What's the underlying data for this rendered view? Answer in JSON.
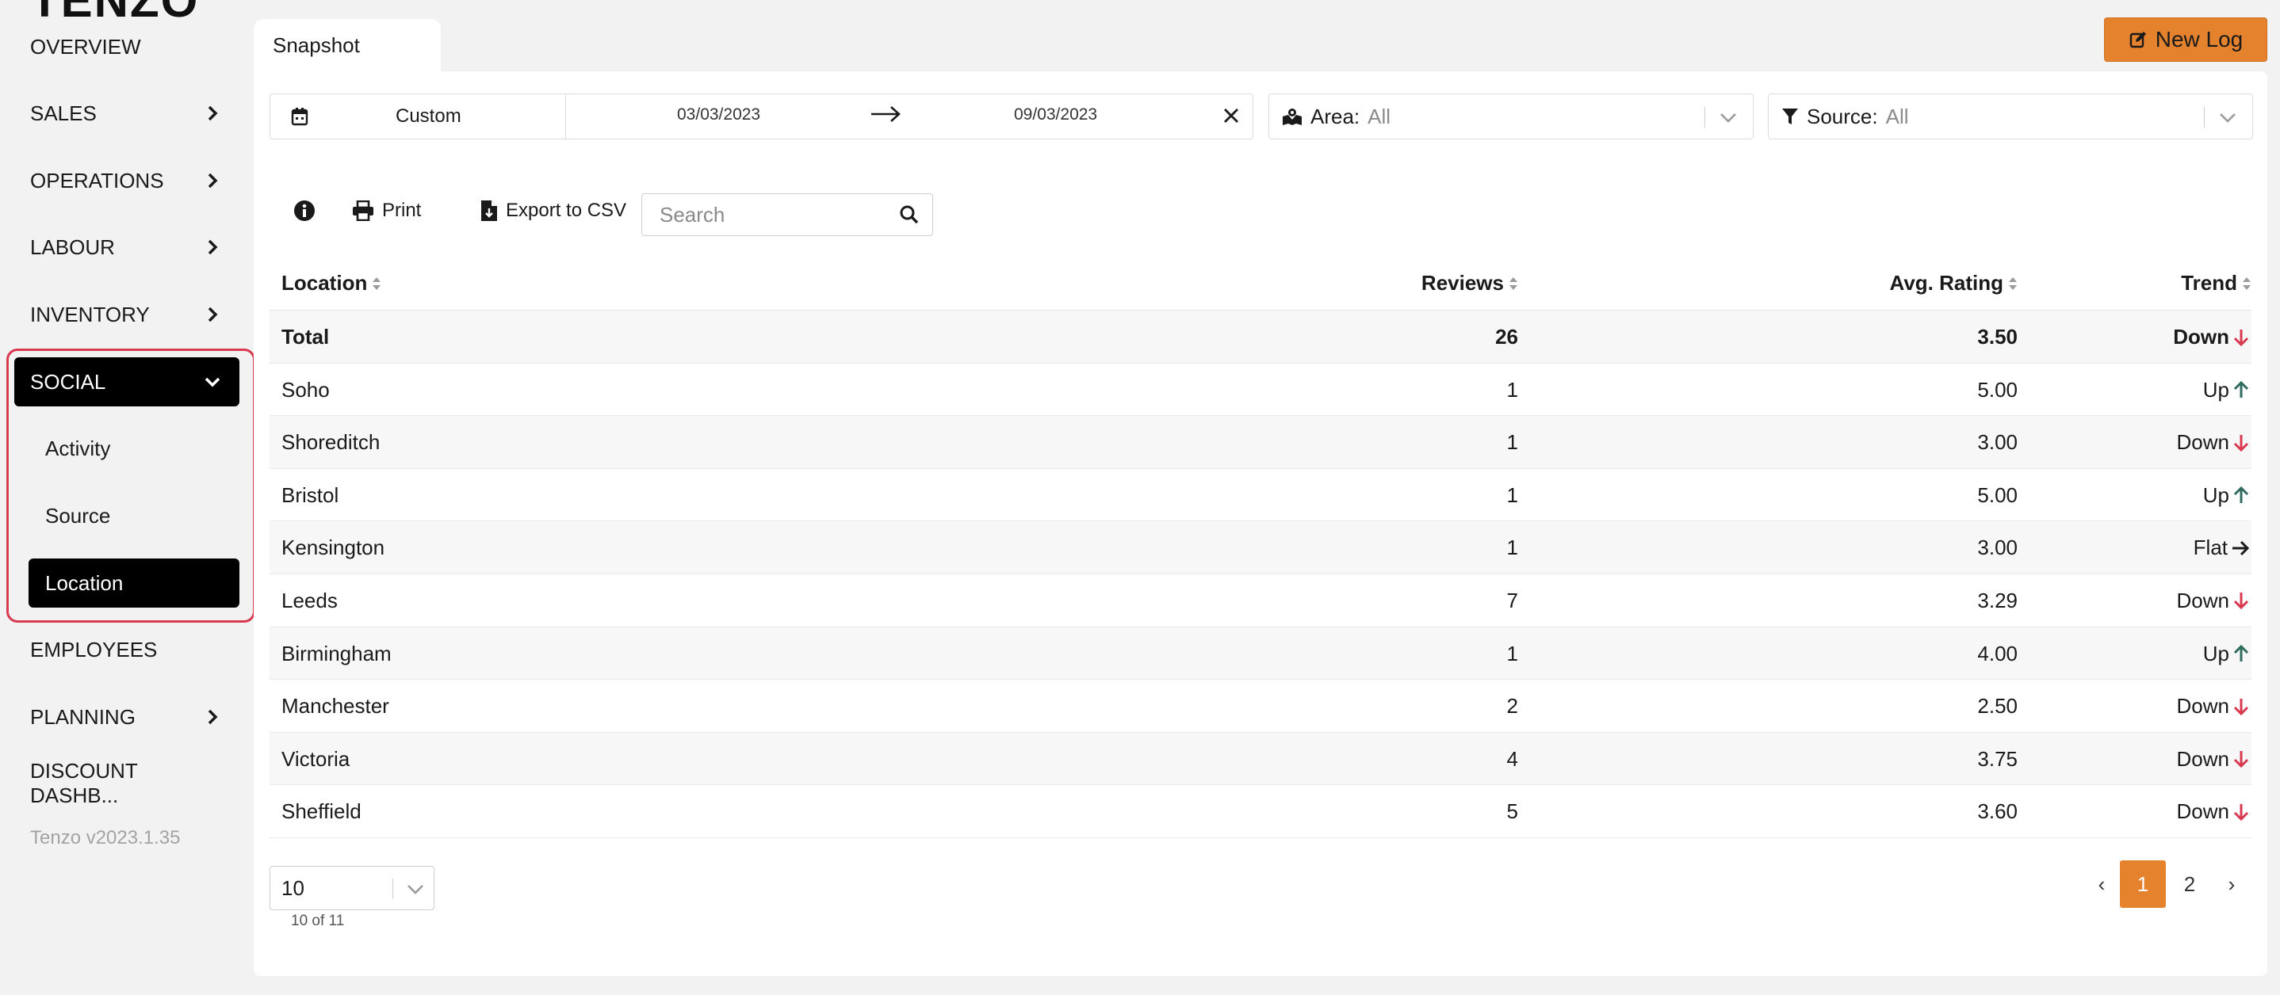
{
  "app": {
    "logo_text": "TENZO",
    "version": "Tenzo v2023.1.35"
  },
  "sidebar": {
    "items": [
      {
        "label": "OVERVIEW"
      },
      {
        "label": "SALES"
      },
      {
        "label": "OPERATIONS"
      },
      {
        "label": "LABOUR"
      },
      {
        "label": "INVENTORY"
      },
      {
        "label": "SOCIAL"
      },
      {
        "label": "EMPLOYEES"
      },
      {
        "label": "PLANNING"
      },
      {
        "label": "DISCOUNT DASHB..."
      }
    ],
    "social_sub": [
      {
        "label": "Activity"
      },
      {
        "label": "Source"
      },
      {
        "label": "Location"
      }
    ]
  },
  "header": {
    "tab_label": "Snapshot",
    "new_log_label": "New Log"
  },
  "filters": {
    "date_preset": "Custom",
    "date_from": "03/03/2023",
    "date_to": "09/03/2023",
    "area_label": "Area:",
    "area_value": "All",
    "source_label": "Source:",
    "source_value": "All"
  },
  "toolbar": {
    "print_label": "Print",
    "export_label": "Export to CSV",
    "search_placeholder": "Search"
  },
  "table": {
    "headers": {
      "location": "Location",
      "reviews": "Reviews",
      "avg_rating": "Avg. Rating",
      "trend": "Trend"
    },
    "rows": [
      {
        "location": "Total",
        "reviews": "26",
        "avg": "3.50",
        "trend": "Down",
        "dir": "down"
      },
      {
        "location": "Soho",
        "reviews": "1",
        "avg": "5.00",
        "trend": "Up",
        "dir": "up"
      },
      {
        "location": "Shoreditch",
        "reviews": "1",
        "avg": "3.00",
        "trend": "Down",
        "dir": "down"
      },
      {
        "location": "Bristol",
        "reviews": "1",
        "avg": "5.00",
        "trend": "Up",
        "dir": "up"
      },
      {
        "location": "Kensington",
        "reviews": "1",
        "avg": "3.00",
        "trend": "Flat",
        "dir": "flat"
      },
      {
        "location": "Leeds",
        "reviews": "7",
        "avg": "3.29",
        "trend": "Down",
        "dir": "down"
      },
      {
        "location": "Birmingham",
        "reviews": "1",
        "avg": "4.00",
        "trend": "Up",
        "dir": "up"
      },
      {
        "location": "Manchester",
        "reviews": "2",
        "avg": "2.50",
        "trend": "Down",
        "dir": "down"
      },
      {
        "location": "Victoria",
        "reviews": "4",
        "avg": "3.75",
        "trend": "Down",
        "dir": "down"
      },
      {
        "location": "Sheffield",
        "reviews": "5",
        "avg": "3.60",
        "trend": "Down",
        "dir": "down"
      }
    ]
  },
  "pagination": {
    "page_size": "10",
    "info": "10 of 11",
    "prev": "‹",
    "next": "›",
    "pages": [
      "1",
      "2"
    ],
    "current_page": "1"
  },
  "colors": {
    "accent": "#e5822e",
    "active_nav": "#000000",
    "highlight_border": "#d9394f",
    "trend_up": "#2f6b5e",
    "trend_down": "#d9394f",
    "trend_flat": "#1a1a1a"
  }
}
